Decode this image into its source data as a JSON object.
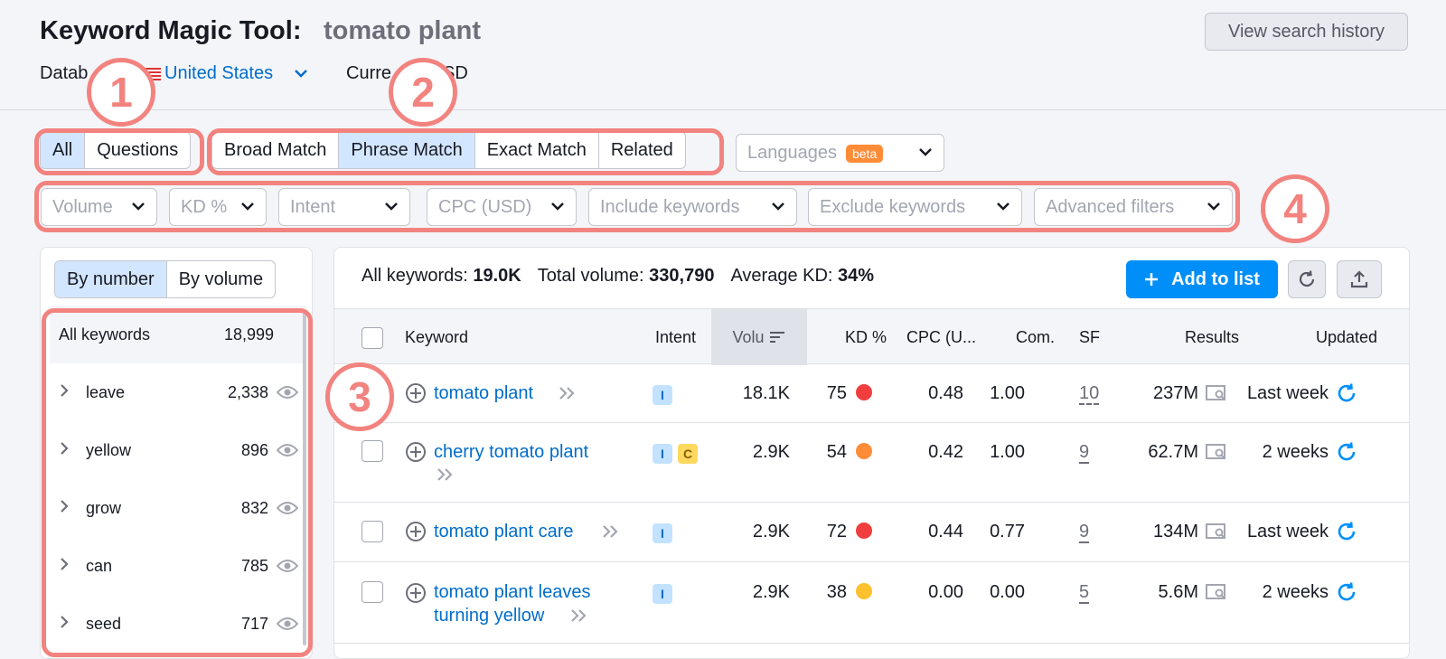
{
  "header": {
    "title": "Keyword Magic Tool:",
    "query": "tomato plant",
    "history_button": "View search history",
    "database_label": "Datab",
    "database_value": "United States",
    "currency_label": "Curre",
    "currency_value": "SD"
  },
  "match_tabs": {
    "group1": [
      "All",
      "Questions"
    ],
    "group2": [
      "Broad Match",
      "Phrase Match",
      "Exact Match",
      "Related"
    ],
    "active": [
      "All",
      "Phrase Match"
    ]
  },
  "languages": {
    "label": "Languages",
    "badge": "beta"
  },
  "filters": [
    "Volume",
    "KD %",
    "Intent",
    "CPC (USD)",
    "Include keywords",
    "Exclude keywords",
    "Advanced filters"
  ],
  "annotations": [
    "1",
    "2",
    "3",
    "4"
  ],
  "sidebar": {
    "toggle": [
      "By number",
      "By volume"
    ],
    "all_label": "All keywords",
    "all_count": "18,999",
    "groups": [
      {
        "word": "leave",
        "count": "2,338"
      },
      {
        "word": "yellow",
        "count": "896"
      },
      {
        "word": "grow",
        "count": "832"
      },
      {
        "word": "can",
        "count": "785"
      },
      {
        "word": "seed",
        "count": "717"
      }
    ]
  },
  "summary": {
    "all_keywords_label": "All keywords:",
    "all_keywords_value": "19.0K",
    "total_volume_label": "Total volume:",
    "total_volume_value": "330,790",
    "avg_kd_label": "Average KD:",
    "avg_kd_value": "34%",
    "add_button": "Add to list"
  },
  "table": {
    "headers": [
      "Keyword",
      "Intent",
      "Volu",
      "KD %",
      "CPC (U...",
      "Com.",
      "SF",
      "Results",
      "Updated"
    ],
    "rows": [
      {
        "keyword": "tomato plant",
        "keyword2": "",
        "intents": [
          "I"
        ],
        "volume": "18.1K",
        "kd": "75",
        "kd_color": "#f03e3e",
        "cpc": "0.48",
        "com": "1.00",
        "sf": "10",
        "results": "237M",
        "updated": "Last week"
      },
      {
        "keyword": "cherry tomato plant",
        "keyword2": "",
        "intents": [
          "I",
          "C"
        ],
        "volume": "2.9K",
        "kd": "54",
        "kd_color": "#ff8c37",
        "cpc": "0.42",
        "com": "1.00",
        "sf": "9",
        "results": "62.7M",
        "updated": "2 weeks"
      },
      {
        "keyword": "tomato plant care",
        "keyword2": "",
        "intents": [
          "I"
        ],
        "volume": "2.9K",
        "kd": "72",
        "kd_color": "#f03e3e",
        "cpc": "0.44",
        "com": "0.77",
        "sf": "9",
        "results": "134M",
        "updated": "Last week"
      },
      {
        "keyword": "tomato plant leaves",
        "keyword2": "turning yellow",
        "intents": [
          "I"
        ],
        "volume": "2.9K",
        "kd": "38",
        "kd_color": "#fcc12c",
        "cpc": "0.00",
        "com": "0.00",
        "sf": "5",
        "results": "5.6M",
        "updated": "2 weeks"
      }
    ]
  }
}
